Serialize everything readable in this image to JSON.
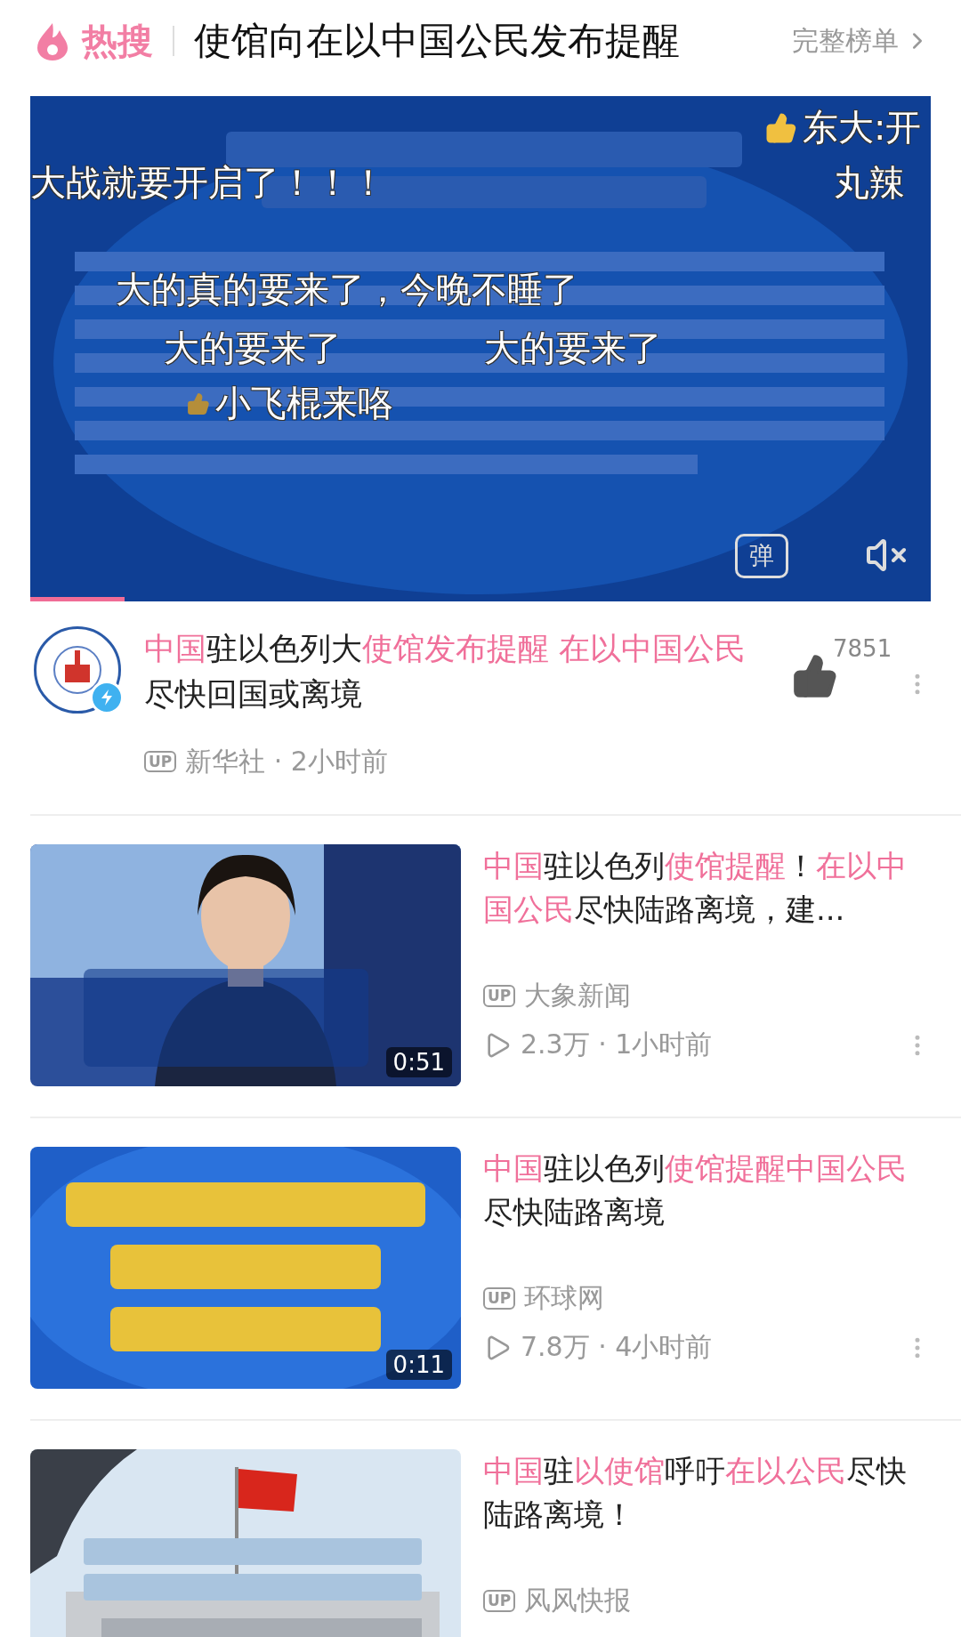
{
  "header": {
    "brand": "热搜",
    "topic": "使馆向在以中国公民发布提醒",
    "full_list": "完整榜单"
  },
  "player": {
    "progress": {
      "level": 0.105
    },
    "danmaku_toggle": "弹",
    "muted": true,
    "danmaku": [
      {
        "text": "大战就要开启了！！！",
        "kind": "plain"
      },
      {
        "text": "东大:开",
        "kind": "liked"
      },
      {
        "text": "丸辣",
        "kind": "plain"
      },
      {
        "text": "大的真的要来了，今晚不睡了",
        "kind": "plain"
      },
      {
        "text": "大的要来了",
        "kind": "plain"
      },
      {
        "text": "大的要来了",
        "kind": "plain"
      },
      {
        "text": "小飞棍来咯",
        "kind": "liked"
      }
    ]
  },
  "main_video": {
    "title": [
      {
        "text": "中国",
        "highlight": true
      },
      {
        "text": "驻以色列大",
        "highlight": false
      },
      {
        "text": "使馆发布提醒 在以中国公民",
        "highlight": true
      },
      {
        "text": "尽快回国或离境",
        "highlight": false
      }
    ],
    "likes": "7851",
    "up_badge": "UP",
    "byline": "新华社 · 2小时前"
  },
  "videos": [
    {
      "title": [
        {
          "text": "中国",
          "highlight": true
        },
        {
          "text": "驻以色列",
          "highlight": false
        },
        {
          "text": "使馆提醒",
          "highlight": true
        },
        {
          "text": "！",
          "highlight": false
        },
        {
          "text": "在以中国公民",
          "highlight": true
        },
        {
          "text": "尽快陆路离境，建...",
          "highlight": false
        }
      ],
      "duration": "0:51",
      "up_badge": "UP",
      "author": "大象新闻",
      "stats": "2.3万 · 1小时前"
    },
    {
      "title": [
        {
          "text": "中国",
          "highlight": true
        },
        {
          "text": "驻以色列",
          "highlight": false
        },
        {
          "text": "使馆提醒中国公民",
          "highlight": true
        },
        {
          "text": "尽快陆路离境",
          "highlight": false
        }
      ],
      "duration": "0:11",
      "up_badge": "UP",
      "author": "环球网",
      "stats": "7.8万 · 4小时前"
    },
    {
      "title": [
        {
          "text": "中国",
          "highlight": true
        },
        {
          "text": "驻",
          "highlight": false
        },
        {
          "text": "以使馆",
          "highlight": true
        },
        {
          "text": "呼吁",
          "highlight": false
        },
        {
          "text": "在以公民",
          "highlight": true
        },
        {
          "text": "尽快陆路离境！",
          "highlight": false
        }
      ],
      "up_badge": "UP",
      "author": "风风快报"
    }
  ]
}
